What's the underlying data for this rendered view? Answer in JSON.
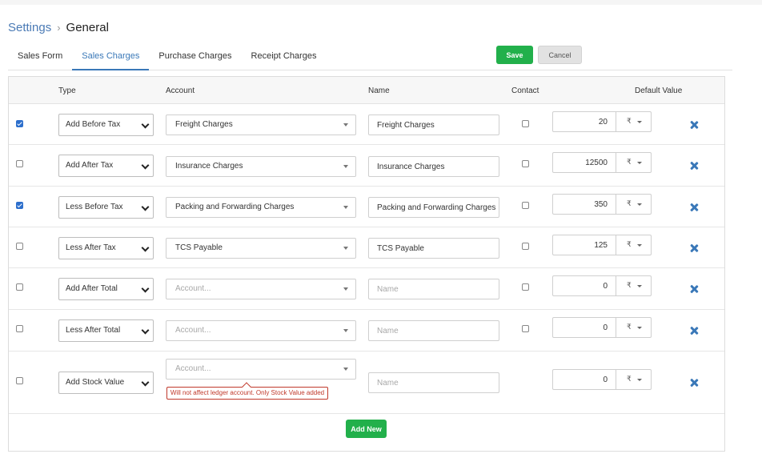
{
  "breadcrumb": {
    "parent": "Settings",
    "separator": "›",
    "current": "General"
  },
  "tabs": [
    {
      "label": "Sales Form",
      "active": false
    },
    {
      "label": "Sales Charges",
      "active": true
    },
    {
      "label": "Purchase Charges",
      "active": false
    },
    {
      "label": "Receipt Charges",
      "active": false
    }
  ],
  "actions": {
    "save_label": "Save",
    "cancel_label": "Cancel",
    "add_new_label": "Add New"
  },
  "columns": {
    "type": "Type",
    "account": "Account",
    "name": "Name",
    "contact": "Contact",
    "default_value": "Default Value"
  },
  "placeholders": {
    "account": "Account...",
    "name": "Name"
  },
  "currency_symbol": "₹",
  "rows": [
    {
      "checked": true,
      "type": "Add Before Tax",
      "account": "Freight Charges",
      "name": "Freight Charges",
      "contact": false,
      "value": "20"
    },
    {
      "checked": false,
      "type": "Add After Tax",
      "account": "Insurance Charges",
      "name": "Insurance Charges",
      "contact": false,
      "value": "12500"
    },
    {
      "checked": true,
      "type": "Less Before Tax",
      "account": "Packing and Forwarding Charges",
      "name": "Packing and Forwarding Charges",
      "contact": false,
      "value": "350"
    },
    {
      "checked": false,
      "type": "Less After Tax",
      "account": "TCS Payable",
      "name": "TCS Payable",
      "contact": false,
      "value": "125"
    },
    {
      "checked": false,
      "type": "Add After Total",
      "account": "",
      "name": "",
      "contact": false,
      "value": "0"
    },
    {
      "checked": false,
      "type": "Less After Total",
      "account": "",
      "name": "",
      "contact": false,
      "value": "0"
    },
    {
      "checked": false,
      "type": "Add Stock Value",
      "account": "",
      "name": "",
      "contact": null,
      "value": "0"
    }
  ],
  "stock_warning": "Will not affect ledger account. Only Stock Value added",
  "colors": {
    "accent": "#3a78b8",
    "primary_button": "#22b04b",
    "warning": "#c0392b"
  }
}
